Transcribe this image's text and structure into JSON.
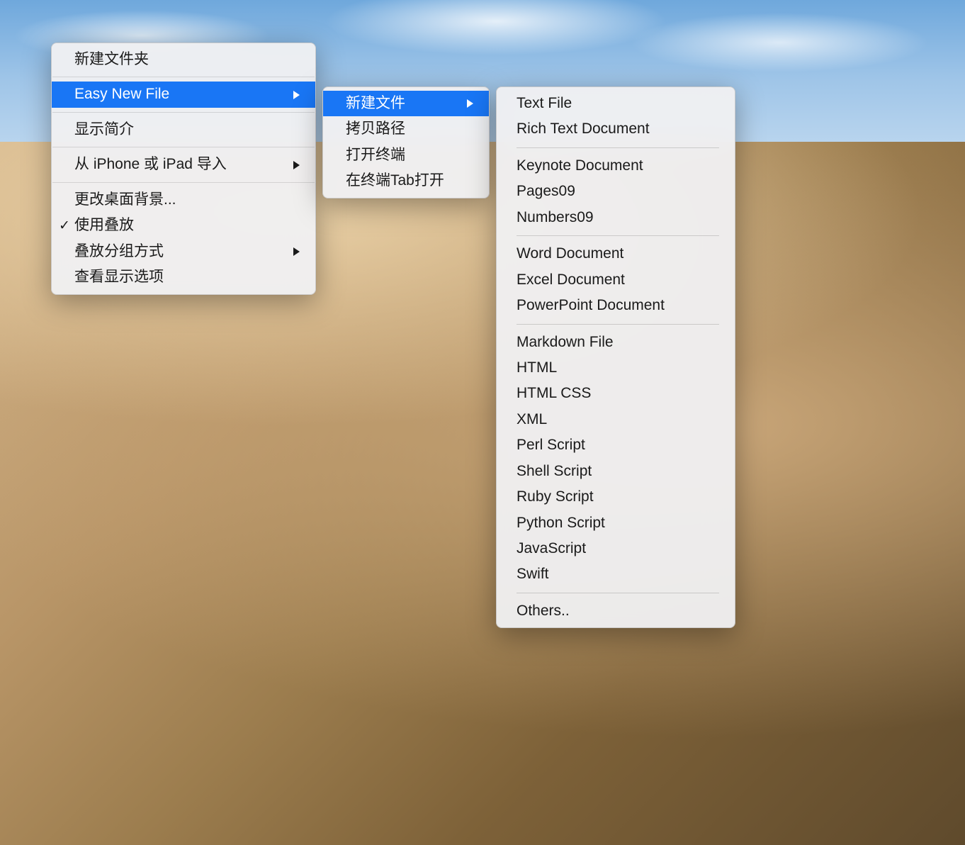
{
  "menu1": {
    "items": [
      {
        "label": "新建文件夹",
        "hasArrow": false,
        "highlighted": false
      },
      {
        "label": "Easy New File",
        "hasArrow": true,
        "highlighted": true
      },
      {
        "label": "显示简介",
        "hasArrow": false,
        "highlighted": false
      },
      {
        "label": "从 iPhone 或 iPad 导入",
        "hasArrow": true,
        "highlighted": false
      },
      {
        "label": "更改桌面背景...",
        "hasArrow": false,
        "highlighted": false
      },
      {
        "label": "使用叠放",
        "hasArrow": false,
        "highlighted": false,
        "checked": true
      },
      {
        "label": "叠放分组方式",
        "hasArrow": true,
        "highlighted": false
      },
      {
        "label": "查看显示选项",
        "hasArrow": false,
        "highlighted": false
      }
    ]
  },
  "menu2": {
    "items": [
      {
        "label": "新建文件",
        "hasArrow": true,
        "highlighted": true
      },
      {
        "label": "拷贝路径",
        "hasArrow": false,
        "highlighted": false
      },
      {
        "label": "打开终端",
        "hasArrow": false,
        "highlighted": false
      },
      {
        "label": "在终端Tab打开",
        "hasArrow": false,
        "highlighted": false
      }
    ]
  },
  "menu3": {
    "groups": [
      [
        {
          "label": "Text File"
        },
        {
          "label": "Rich Text Document"
        }
      ],
      [
        {
          "label": "Keynote Document"
        },
        {
          "label": "Pages09"
        },
        {
          "label": "Numbers09"
        }
      ],
      [
        {
          "label": "Word Document"
        },
        {
          "label": "Excel Document"
        },
        {
          "label": "PowerPoint Document"
        }
      ],
      [
        {
          "label": "Markdown File"
        },
        {
          "label": "HTML"
        },
        {
          "label": "HTML CSS"
        },
        {
          "label": "XML"
        },
        {
          "label": "Perl Script"
        },
        {
          "label": "Shell Script"
        },
        {
          "label": "Ruby Script"
        },
        {
          "label": "Python Script"
        },
        {
          "label": "JavaScript"
        },
        {
          "label": "Swift"
        }
      ],
      [
        {
          "label": "Others.."
        }
      ]
    ]
  }
}
